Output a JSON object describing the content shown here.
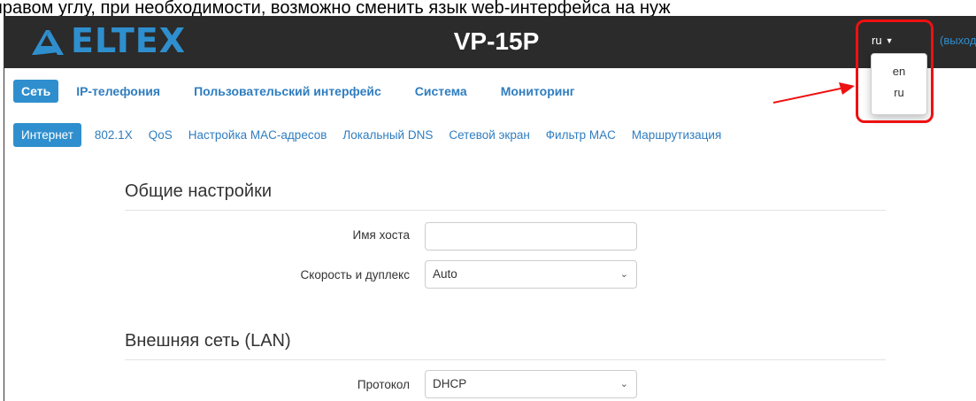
{
  "caption": "правом углу, при необходимости, возможно сменить язык web-интерфейса на нуж",
  "header": {
    "brand": "ELTEX",
    "model": "VP-15P",
    "lang_current": "ru",
    "logout": "(выход"
  },
  "lang_menu": {
    "options": [
      "en",
      "ru"
    ]
  },
  "main_nav": {
    "items": [
      "Сеть",
      "IP-телефония",
      "Пользовательский интерфейс",
      "Система",
      "Мониторинг"
    ],
    "active": "Сеть"
  },
  "sub_nav": {
    "items": [
      "Интернет",
      "802.1X",
      "QoS",
      "Настройка MAC-адресов",
      "Локальный DNS",
      "Сетевой экран",
      "Фильтр MAC",
      "Маршрутизация"
    ],
    "active": "Интернет"
  },
  "general": {
    "title": "Общие настройки",
    "hostname_label": "Имя хоста",
    "hostname_value": "",
    "speed_label": "Скорость и дуплекс",
    "speed_value": "Auto"
  },
  "lan": {
    "title": "Внешняя сеть (LAN)",
    "protocol_label": "Протокол",
    "protocol_value": "DHCP"
  },
  "colors": {
    "accent": "#2f8fce",
    "header_bg": "#2b2b2b",
    "highlight": "#e11111"
  }
}
